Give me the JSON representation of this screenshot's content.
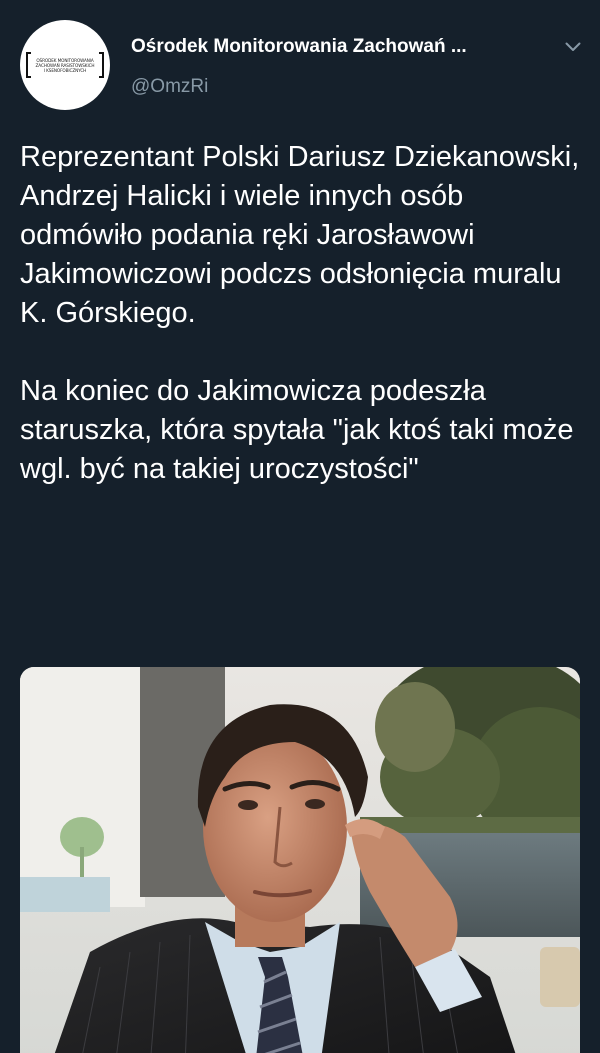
{
  "author": {
    "display_name": "Ośrodek Monitorowania Zachowań ...",
    "handle": "@OmzRi",
    "avatar_lines": [
      "OŚRODEK MONITOROWANIA",
      "ZACHOWAŃ RASISTOWSKICH",
      "I KSENOFOBICZNYCH"
    ]
  },
  "tweet": {
    "paragraphs": [
      "Reprezentant Polski Dariusz Dziekanowski, Andrzej Halicki i wiele innych osób odmówiło podania ręki Jarosławowi Jakimowiczowi podczs odsłonięcia muralu K. Górskiego.",
      "Na koniec do Jakimowicza podeszła staruszka, która spytała \"jak ktoś taki może wgl. być na takiej uroczystości\""
    ]
  },
  "icons": {
    "caret": "chevron-down-icon"
  },
  "colors": {
    "background": "#15202b",
    "text": "#ffffff",
    "secondary_text": "#8899a6"
  }
}
